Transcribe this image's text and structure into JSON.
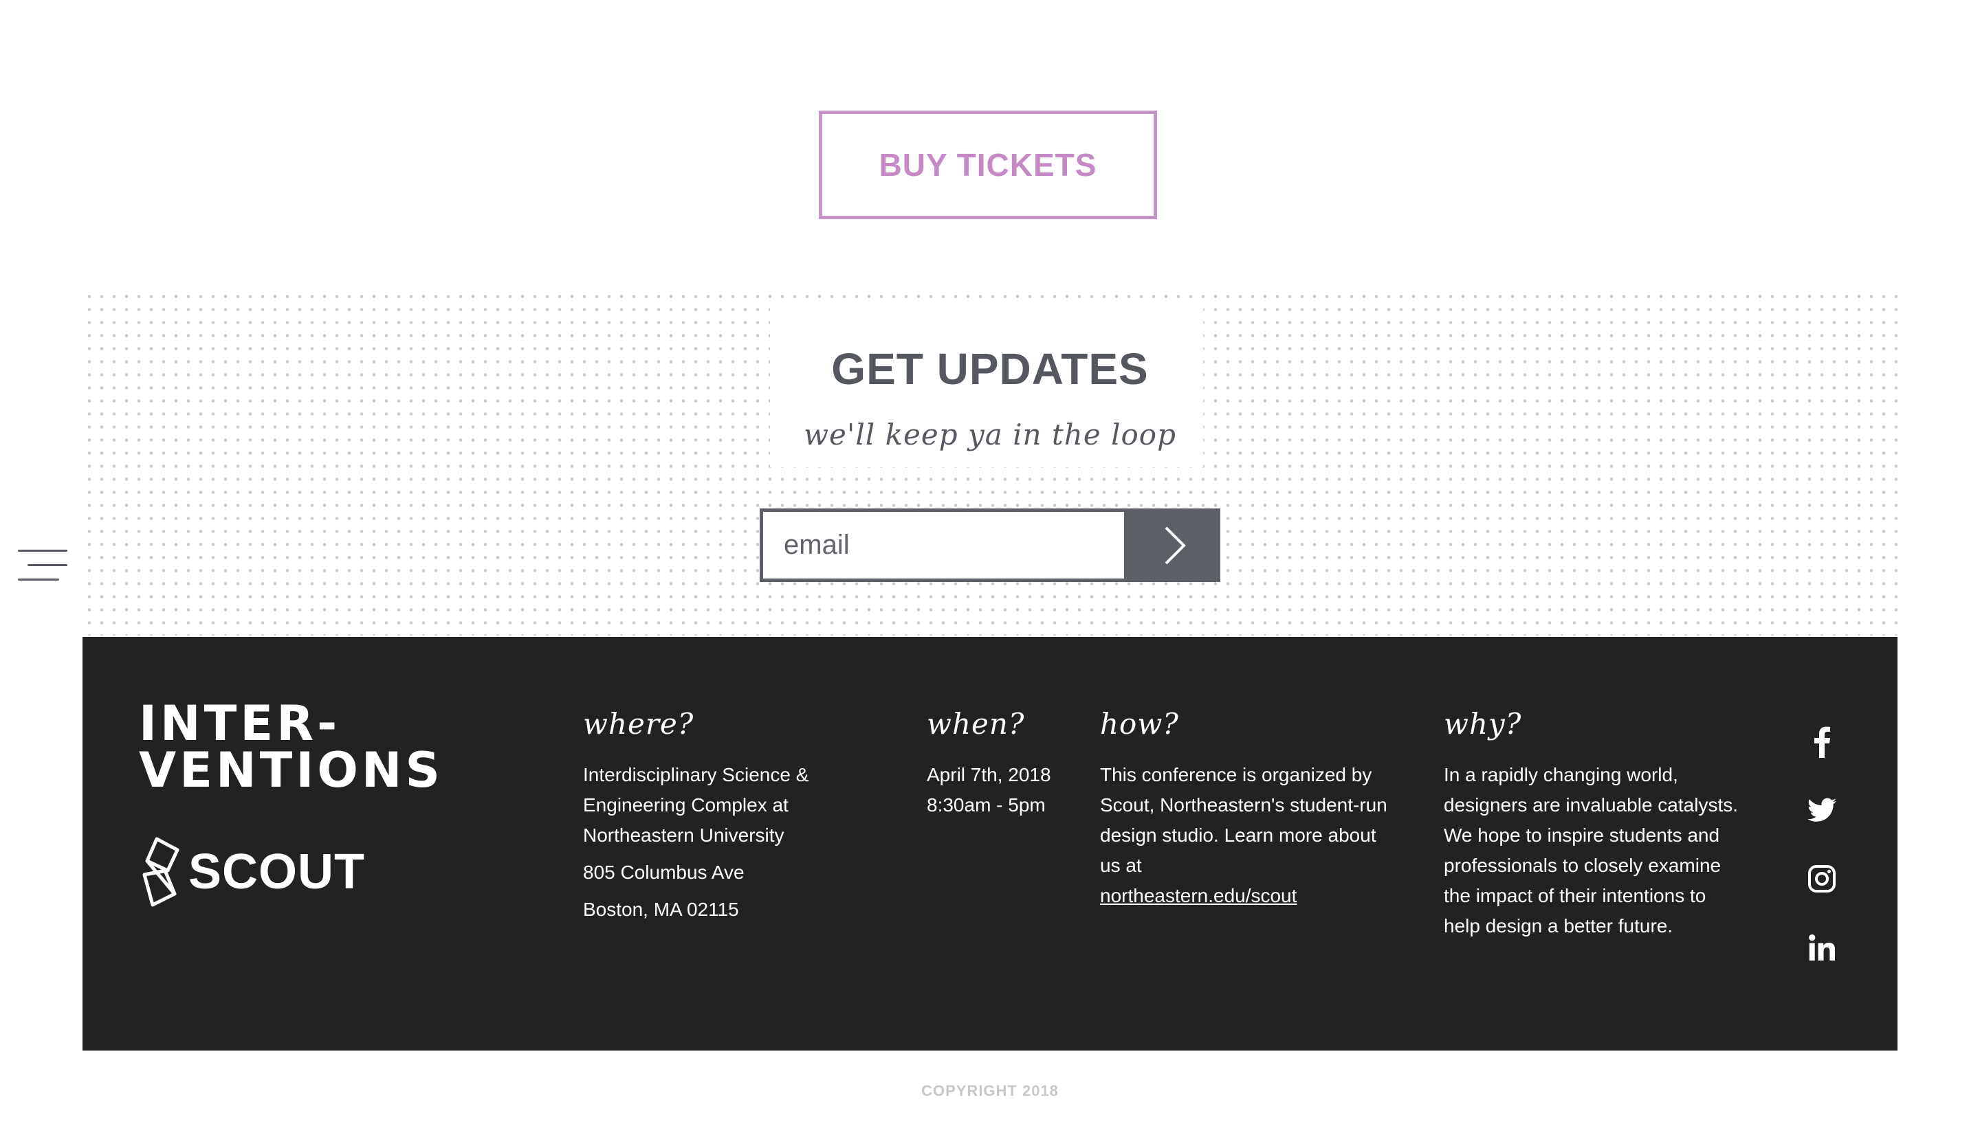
{
  "buy_tickets": {
    "label": "BUY TICKETS"
  },
  "updates": {
    "title": "GET UPDATES",
    "subtitle": "we'll keep ya in the loop",
    "email_placeholder": "email"
  },
  "footer": {
    "logo_line1": "INTER-",
    "logo_line2": "VENTIONS",
    "scout_label": "SCOUT",
    "where": {
      "heading": "where?",
      "venue": "Interdisciplinary Science & Engineering Complex at Northeastern University",
      "street": "805 Columbus Ave",
      "city": "Boston, MA 02115"
    },
    "when": {
      "heading": "when?",
      "date": "April 7th, 2018",
      "time": "8:30am - 5pm"
    },
    "how": {
      "heading": "how?",
      "text": "This conference is organized by Scout, Northeastern's student-run design studio. Learn more about us at",
      "link": "northeastern.edu/scout"
    },
    "why": {
      "heading": "why?",
      "text": "In a rapidly changing world, designers are invaluable catalysts. We hope to inspire students and professionals to closely examine the impact of their intentions to help design a better future."
    },
    "social_icons": [
      "facebook-icon",
      "twitter-icon",
      "instagram-icon",
      "linkedin-icon"
    ]
  },
  "copyright": "COPYRIGHT 2018",
  "colors": {
    "accent_pink": "#c58ac6",
    "gray": "#55585f",
    "footer_bg": "#222222"
  }
}
